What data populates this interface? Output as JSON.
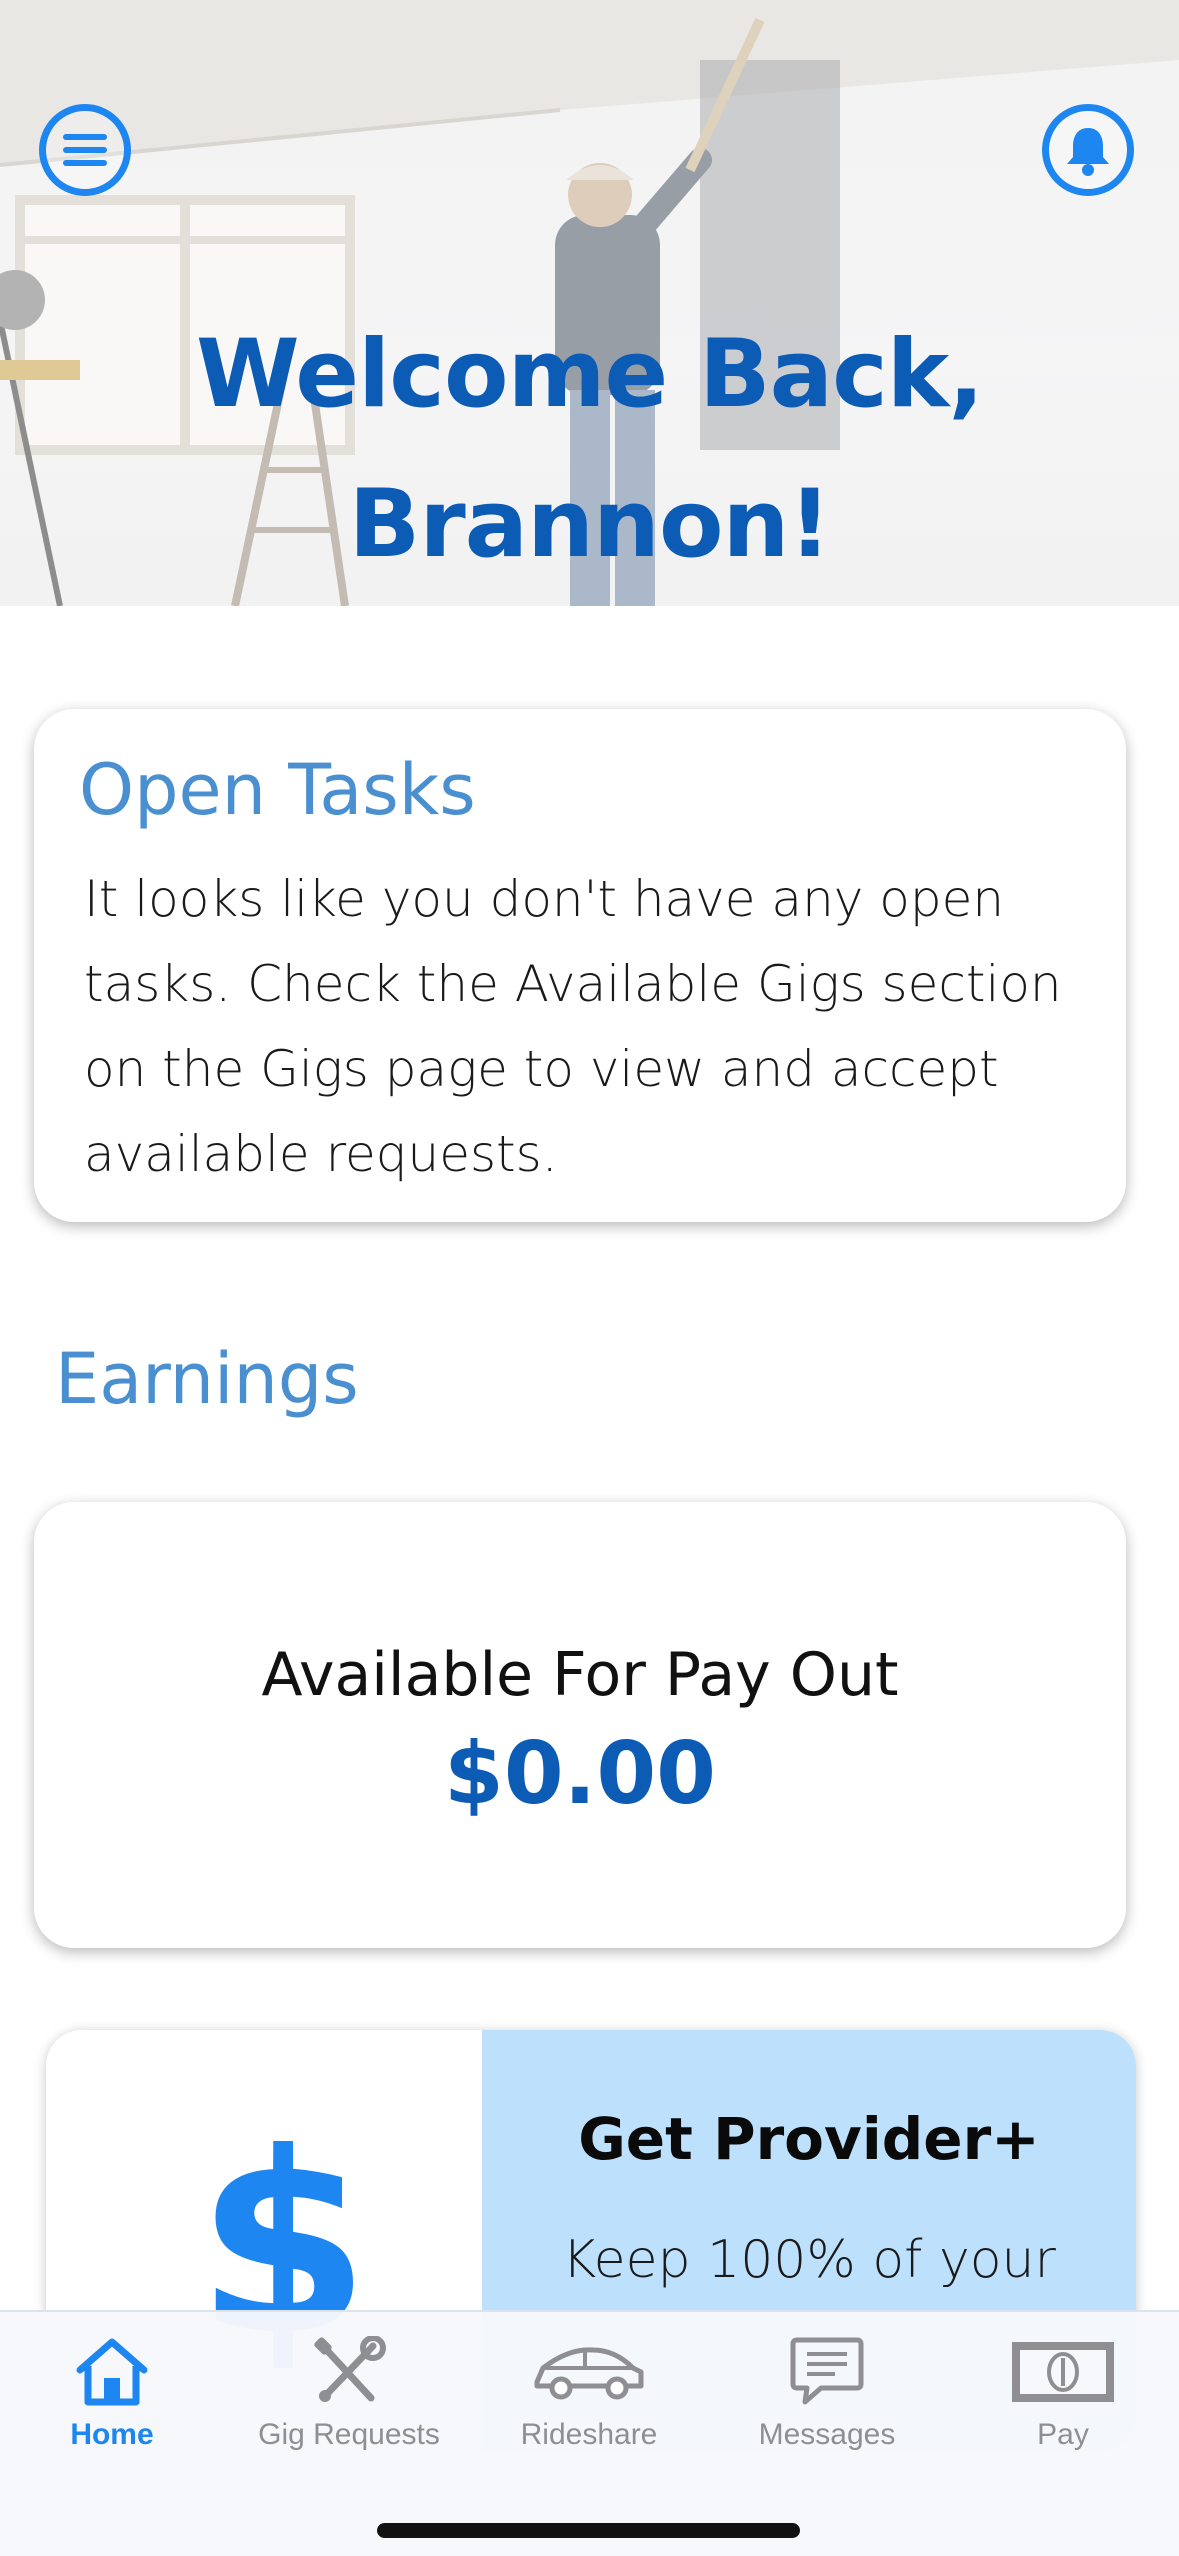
{
  "header": {
    "welcome_line1": "Welcome Back,",
    "welcome_line2": "Brannon!"
  },
  "open_tasks": {
    "title": "Open Tasks",
    "body": "It looks like you don't have any open tasks. Check the Available Gigs section on the Gigs page to view and accept available requests."
  },
  "earnings": {
    "heading": "Earnings",
    "payout_label": "Available For Pay Out",
    "payout_amount": "$0.00"
  },
  "promo": {
    "icon_glyph": "$",
    "title": "Get Provider+",
    "text": "Keep 100% of your"
  },
  "tabbar": {
    "tabs": [
      {
        "label": "Home",
        "icon": "home-icon",
        "active": true
      },
      {
        "label": "Gig Requests",
        "icon": "tools-icon",
        "active": false
      },
      {
        "label": "Rideshare",
        "icon": "car-icon",
        "active": false
      },
      {
        "label": "Messages",
        "icon": "chat-icon",
        "active": false
      },
      {
        "label": "Pay",
        "icon": "cash-icon",
        "active": false
      }
    ]
  },
  "colors": {
    "accent": "#1e86f0",
    "title_blue": "#0c5bb4",
    "section_blue": "#4a8fd0",
    "promo_bg": "#bde0fc",
    "inactive_tab": "#8e8e93"
  }
}
